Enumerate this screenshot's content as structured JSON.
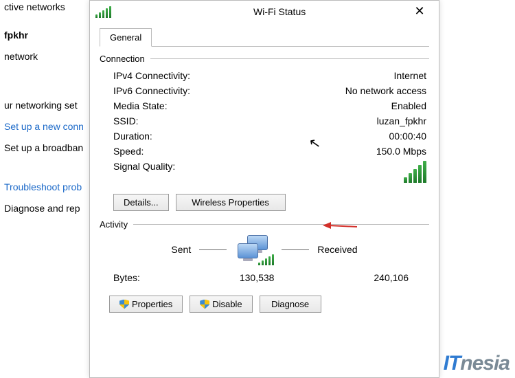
{
  "background": {
    "heading_fragment": "ctive networks",
    "network_name": "fpkhr",
    "network_type": "network",
    "settings_fragment": "ur networking set",
    "link_new_conn": "Set up a new conn",
    "link_broadband": "Set up a broadban",
    "link_troubleshoot": "Troubleshoot prob",
    "link_diagnose": "Diagnose and rep"
  },
  "dialog": {
    "title": "Wi-Fi Status",
    "tab_general": "General",
    "connection": {
      "label": "Connection",
      "ipv4_label": "IPv4 Connectivity:",
      "ipv4_value": "Internet",
      "ipv6_label": "IPv6 Connectivity:",
      "ipv6_value": "No network access",
      "media_label": "Media State:",
      "media_value": "Enabled",
      "ssid_label": "SSID:",
      "ssid_value": "luzan_fpkhr",
      "duration_label": "Duration:",
      "duration_value": "00:00:40",
      "speed_label": "Speed:",
      "speed_value": "150.0 Mbps",
      "signal_label": "Signal Quality:"
    },
    "buttons": {
      "details": "Details...",
      "wireless_props": "Wireless Properties",
      "properties": "Properties",
      "disable": "Disable",
      "diagnose": "Diagnose"
    },
    "activity": {
      "label": "Activity",
      "sent_label": "Sent",
      "received_label": "Received",
      "bytes_label": "Bytes:",
      "bytes_sent": "130,538",
      "bytes_received": "240,106"
    }
  },
  "watermark": {
    "it": "IT",
    "nesia": "nesia"
  }
}
